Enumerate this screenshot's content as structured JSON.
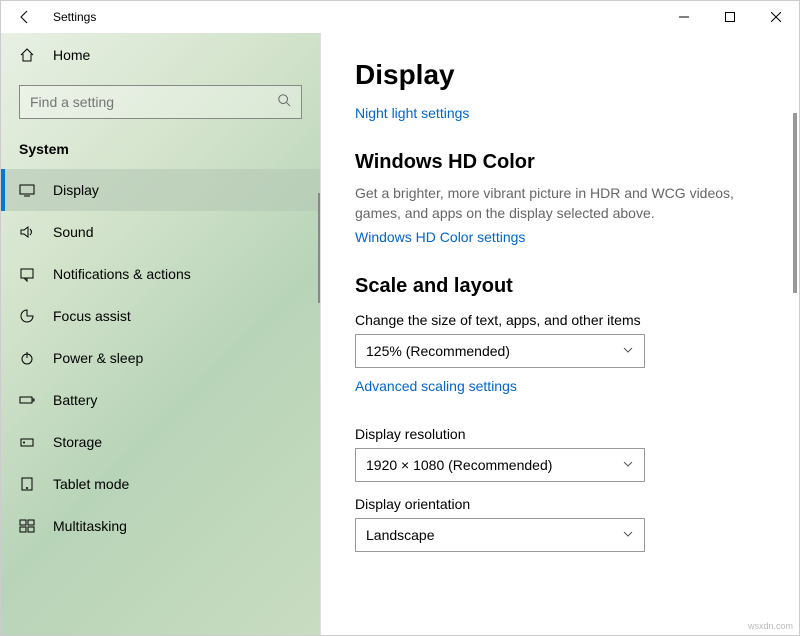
{
  "window": {
    "app_title": "Settings"
  },
  "sidebar": {
    "home_label": "Home",
    "search_placeholder": "Find a setting",
    "category": "System",
    "items": [
      {
        "label": "Display",
        "icon": "display-icon",
        "active": true
      },
      {
        "label": "Sound",
        "icon": "sound-icon",
        "active": false
      },
      {
        "label": "Notifications & actions",
        "icon": "notifications-icon",
        "active": false
      },
      {
        "label": "Focus assist",
        "icon": "focus-icon",
        "active": false
      },
      {
        "label": "Power & sleep",
        "icon": "power-icon",
        "active": false
      },
      {
        "label": "Battery",
        "icon": "battery-icon",
        "active": false
      },
      {
        "label": "Storage",
        "icon": "storage-icon",
        "active": false
      },
      {
        "label": "Tablet mode",
        "icon": "tablet-icon",
        "active": false
      },
      {
        "label": "Multitasking",
        "icon": "multitasking-icon",
        "active": false
      }
    ]
  },
  "main": {
    "page_title": "Display",
    "night_light_link": "Night light settings",
    "hd_color": {
      "title": "Windows HD Color",
      "desc": "Get a brighter, more vibrant picture in HDR and WCG videos, games, and apps on the display selected above.",
      "link": "Windows HD Color settings"
    },
    "scale": {
      "title": "Scale and layout",
      "size_label": "Change the size of text, apps, and other items",
      "size_value": "125% (Recommended)",
      "advanced_link": "Advanced scaling settings",
      "resolution_label": "Display resolution",
      "resolution_value": "1920 × 1080 (Recommended)",
      "orientation_label": "Display orientation",
      "orientation_value": "Landscape"
    }
  },
  "watermark": "wsxdn.com"
}
